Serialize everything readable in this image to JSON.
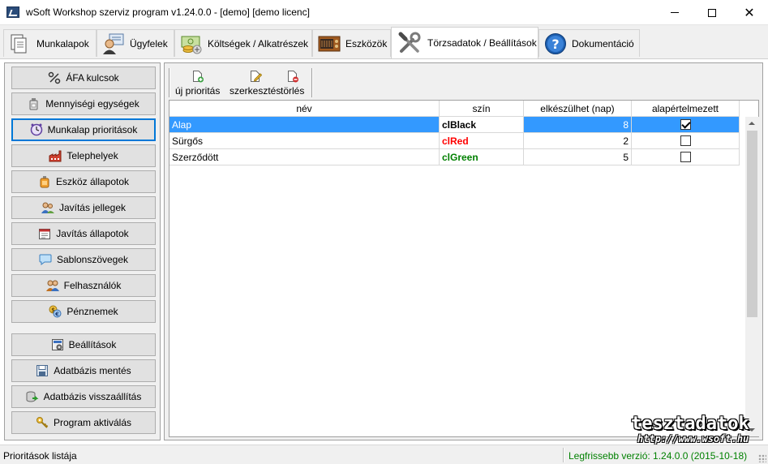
{
  "window": {
    "title": "wSoft Workshop szerviz program v1.24.0.0 - [demo] [demo licenc]"
  },
  "tabs": [
    {
      "label": "Munkalapok",
      "icon": "documents-icon"
    },
    {
      "label": "Ügyfelek",
      "icon": "customer-icon"
    },
    {
      "label": "Költségek / Alkatrészek",
      "icon": "money-icon"
    },
    {
      "label": "Eszközök",
      "icon": "device-icon"
    },
    {
      "label": "Törzsadatok / Beállítások",
      "icon": "tools-icon",
      "active": true
    },
    {
      "label": "Dokumentáció",
      "icon": "help-icon"
    }
  ],
  "sidebar": {
    "items": [
      {
        "label": "ÁFA kulcsok",
        "icon": "percent-icon"
      },
      {
        "label": "Mennyiségi egységek",
        "icon": "bottle-icon"
      },
      {
        "label": "Munkalap prioritások",
        "icon": "clock-icon",
        "focused": true
      },
      {
        "label": "Telephelyek",
        "icon": "factory-icon"
      },
      {
        "label": "Eszköz állapotok",
        "icon": "canister-icon"
      },
      {
        "label": "Javítás jellegek",
        "icon": "people-icon"
      },
      {
        "label": "Javítás állapotok",
        "icon": "calendar-icon"
      },
      {
        "label": "Sablonszövegek",
        "icon": "speech-bubble-icon"
      },
      {
        "label": "Felhasználók",
        "icon": "users-icon"
      },
      {
        "label": "Pénznemek",
        "icon": "currency-icon"
      },
      {
        "label": "Beállítások",
        "icon": "settings-icon"
      },
      {
        "label": "Adatbázis mentés",
        "icon": "database-save-icon"
      },
      {
        "label": "Adatbázis visszaállítás",
        "icon": "database-restore-icon"
      },
      {
        "label": "Program aktiválás",
        "icon": "key-icon"
      }
    ]
  },
  "toolbar": {
    "new_label": "új prioritás",
    "edit_label": "szerkesztés",
    "delete_label": "törlés"
  },
  "grid": {
    "columns": [
      "név",
      "szín",
      "elkészülhet (nap)",
      "alapértelmezett"
    ],
    "rows": [
      {
        "name": "Alap",
        "color": "clBlack",
        "color_hex": "#000000",
        "days": "8",
        "default": true,
        "selected": true
      },
      {
        "name": "Sürgős",
        "color": "clRed",
        "color_hex": "#ff0000",
        "days": "2",
        "default": false,
        "selected": false
      },
      {
        "name": "Szerződött",
        "color": "clGreen",
        "color_hex": "#008000",
        "days": "5",
        "default": false,
        "selected": false
      }
    ]
  },
  "watermark": {
    "brand": "tesztadatok",
    "url": "http://www.wsoft.hu"
  },
  "statusbar": {
    "left": "Prioritások listája",
    "right": "Legfrissebb verzió: 1.24.0.0 (2015-10-18)",
    "right_color": "#008000"
  }
}
